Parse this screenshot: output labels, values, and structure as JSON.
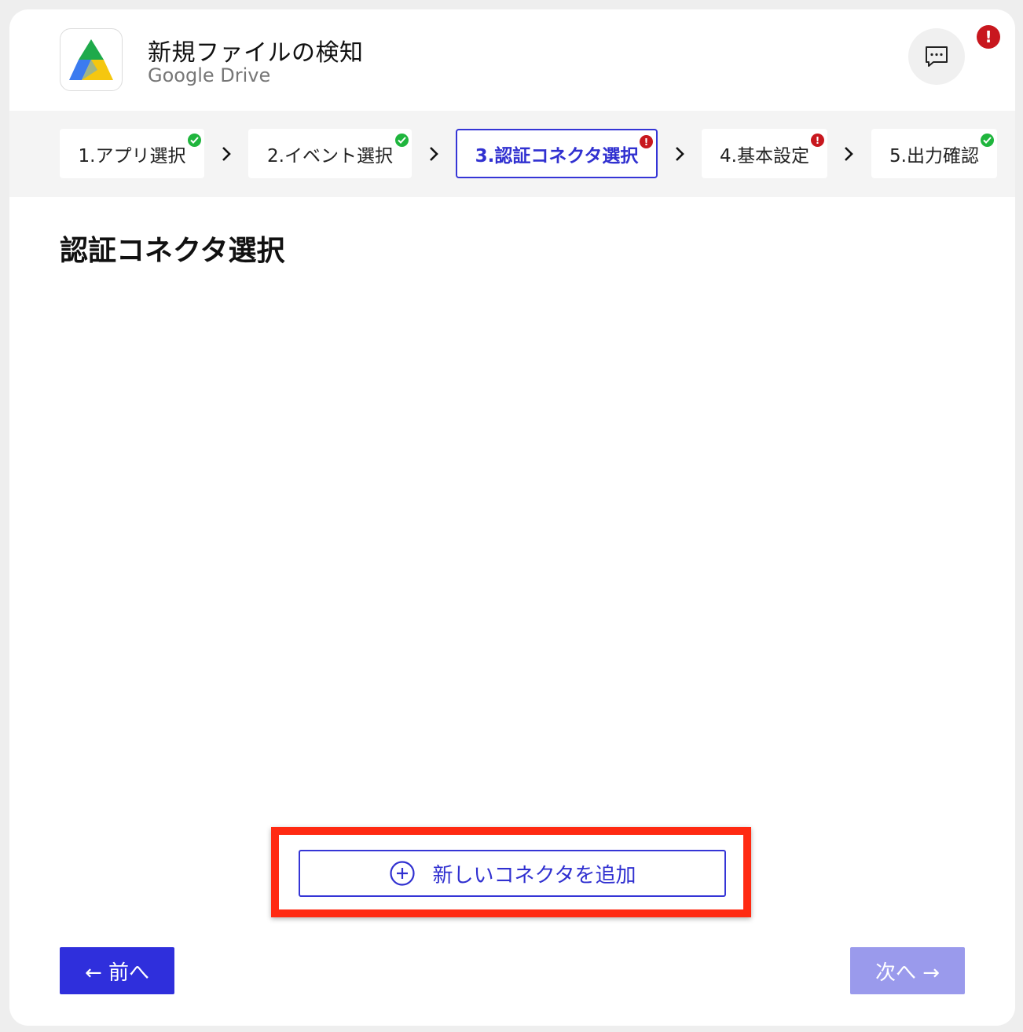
{
  "header": {
    "title": "新規ファイルの検知",
    "subtitle": "Google Drive",
    "alert_glyph": "!",
    "icons": {
      "app": "google-drive-logo-icon",
      "chat": "chat-bubble-icon",
      "alert": "alert-icon"
    }
  },
  "stepper": {
    "steps": [
      {
        "label": "1.アプリ選択",
        "status": "ok"
      },
      {
        "label": "2.イベント選択",
        "status": "ok"
      },
      {
        "label": "3.認証コネクタ選択",
        "status": "error",
        "active": true
      },
      {
        "label": "4.基本設定",
        "status": "error"
      },
      {
        "label": "5.出力確認",
        "status": "ok"
      }
    ],
    "error_glyph": "!"
  },
  "main": {
    "title": "認証コネクタ選択",
    "add_connector_label": "新しいコネクタを追加"
  },
  "footer": {
    "prev_label": "← 前へ",
    "next_label": "次へ →"
  },
  "colors": {
    "accent": "#2f2fdc",
    "accent_disabled": "#9a9aec",
    "ok": "#1fb53d",
    "error": "#c8171e",
    "highlight": "#ff2a12"
  }
}
